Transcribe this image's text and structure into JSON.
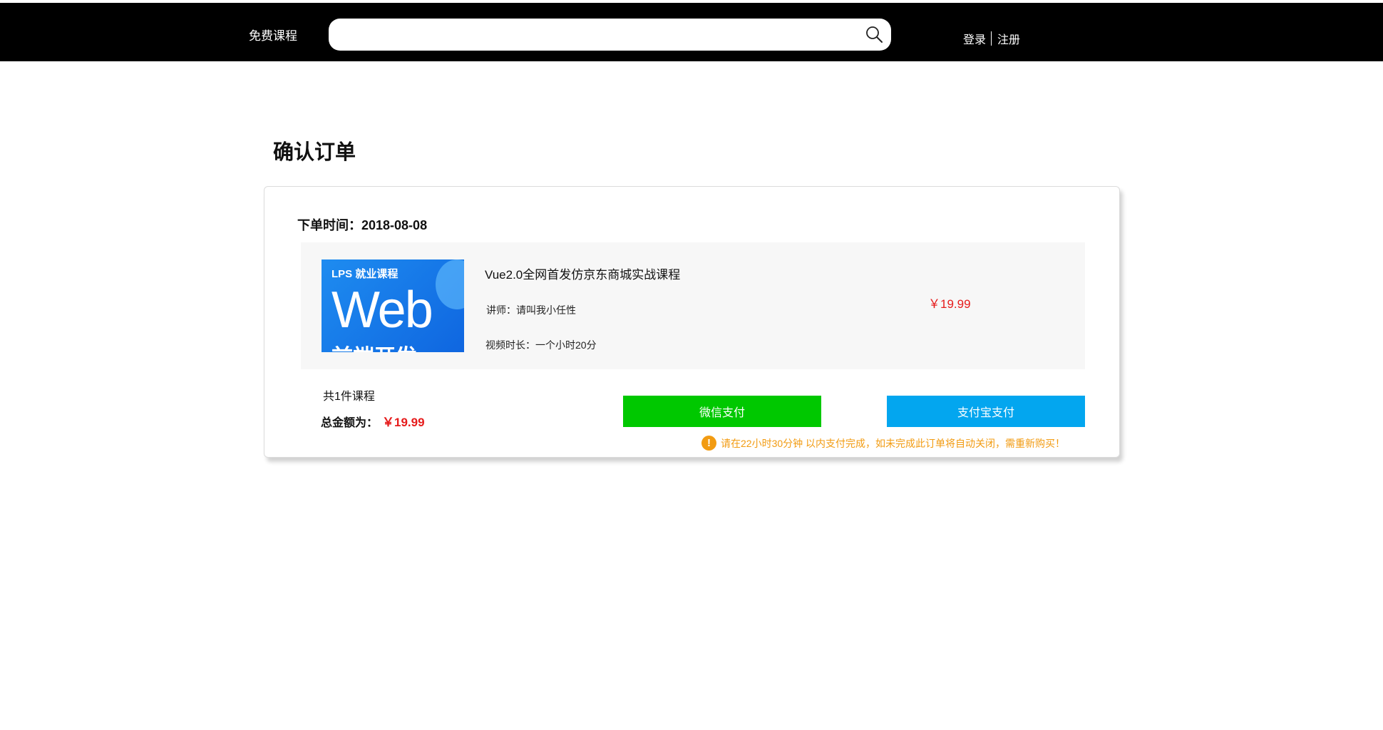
{
  "header": {
    "nav_free_courses": "免费课程",
    "search_placeholder": "",
    "search_icon": "search-icon",
    "login": "登录",
    "register": "注册"
  },
  "page": {
    "title": "确认订单"
  },
  "order": {
    "time_label": "下单时间：",
    "time_value": "2018-08-08",
    "item": {
      "thumb_tag": "LPS 就业课程",
      "thumb_big": "Web",
      "thumb_sub": "前端开发",
      "name": "Vue2.0全网首发仿京东商城实战课程",
      "teacher": "讲师：请叫我小任性",
      "duration": "视频时长：一个小时20分",
      "price": "￥19.99"
    },
    "count_text": "共1件课程",
    "total_label": "总金额为：",
    "total_value": "￥19.99",
    "wechat_pay": "微信支付",
    "alipay_pay": "支付宝支付",
    "notice_icon": "warning-icon",
    "notice": "请在22小时30分钟 以内支付完成，如未完成此订单将自动关闭，需重新购买！"
  },
  "colors": {
    "header_bg": "#000000",
    "price_red": "#e61b1b",
    "wechat_green": "#00c800",
    "alipay_blue": "#03a6ef",
    "notice_orange": "#f29b11"
  }
}
